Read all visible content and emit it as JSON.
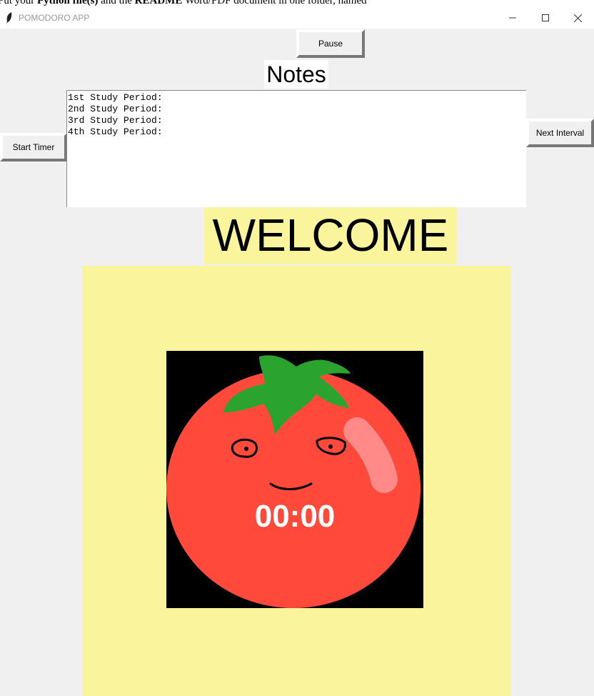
{
  "background_doc": {
    "text_before": "Put your ",
    "bold1": "Python file(s)",
    "text_mid": " and the ",
    "bold2": "README",
    "text_after": " Word/PDF document in one folder, named"
  },
  "window": {
    "title": "POMODORO APP"
  },
  "buttons": {
    "pause": "Pause",
    "start": "Start Timer",
    "next": "Next Interval"
  },
  "notes": {
    "title": "Notes",
    "content": "1st Study Period:\n2nd Study Period:\n3rd Study Period:\n4th Study Period:"
  },
  "welcome": "WELCOME",
  "timer": "00:00",
  "colors": {
    "panel": "#faf59d",
    "tomato": "#ff4a3b",
    "leaf": "#2ba42f",
    "highlight": "#ff8a88"
  }
}
